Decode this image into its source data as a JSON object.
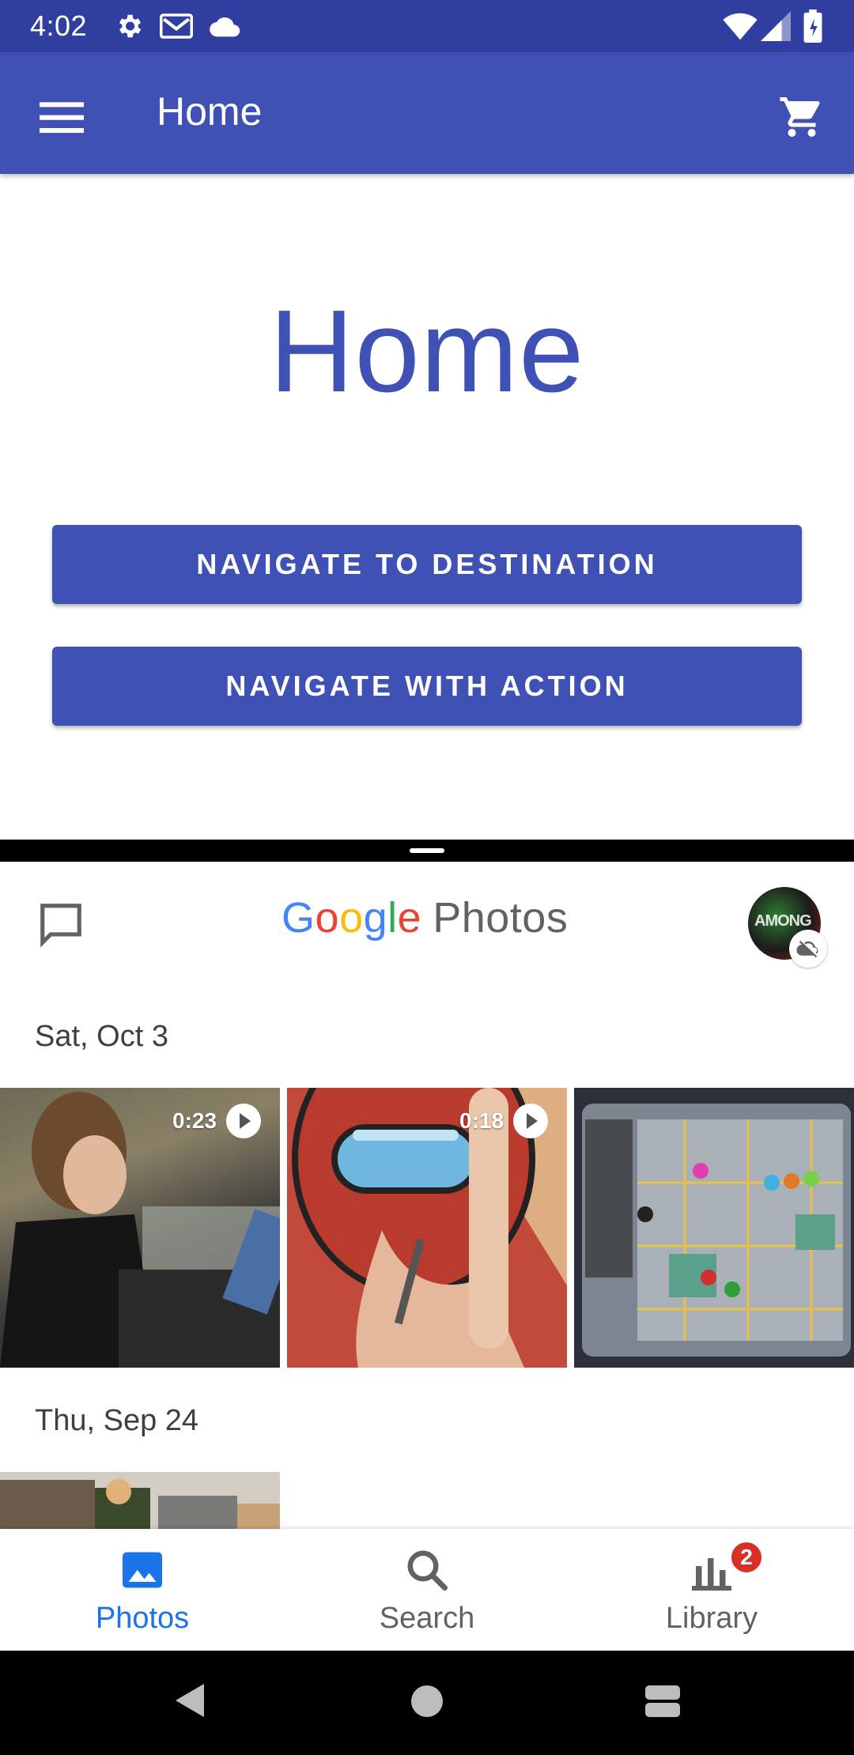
{
  "status_bar": {
    "time": "4:02",
    "icons": [
      "settings-icon",
      "gmail-icon",
      "cloud-icon",
      "wifi-icon",
      "signal-icon",
      "battery-icon"
    ]
  },
  "app_bar": {
    "title": "Home",
    "menu_icon": "menu-icon",
    "cart_icon": "cart-icon",
    "background": "#3f51b5"
  },
  "home": {
    "heading": "Home",
    "buttons": [
      {
        "label": "NAVIGATE TO DESTINATION"
      },
      {
        "label": "NAVIGATE WITH ACTION"
      }
    ]
  },
  "photos": {
    "logo_google": [
      "G",
      "o",
      "o",
      "g",
      "l",
      "e"
    ],
    "logo_photos": "Photos",
    "sections": [
      {
        "date": "Sat, Oct 3",
        "items": [
          {
            "duration": "0:23",
            "type": "video"
          },
          {
            "duration": "0:18",
            "type": "video"
          },
          {
            "duration": "",
            "type": "photo"
          }
        ]
      },
      {
        "date": "Thu, Sep 24",
        "items": [
          {
            "duration": "",
            "type": "photo"
          }
        ]
      }
    ]
  },
  "bottom_nav": {
    "items": [
      {
        "label": "Photos",
        "icon": "photo-icon",
        "active": true
      },
      {
        "label": "Search",
        "icon": "search-icon",
        "active": false
      },
      {
        "label": "Library",
        "icon": "library-icon",
        "active": false,
        "badge": "2"
      }
    ]
  },
  "colors": {
    "status_bar": "#303f9f",
    "primary": "#3f51b5",
    "photos_active": "#1a73e8",
    "badge": "#d93025"
  }
}
